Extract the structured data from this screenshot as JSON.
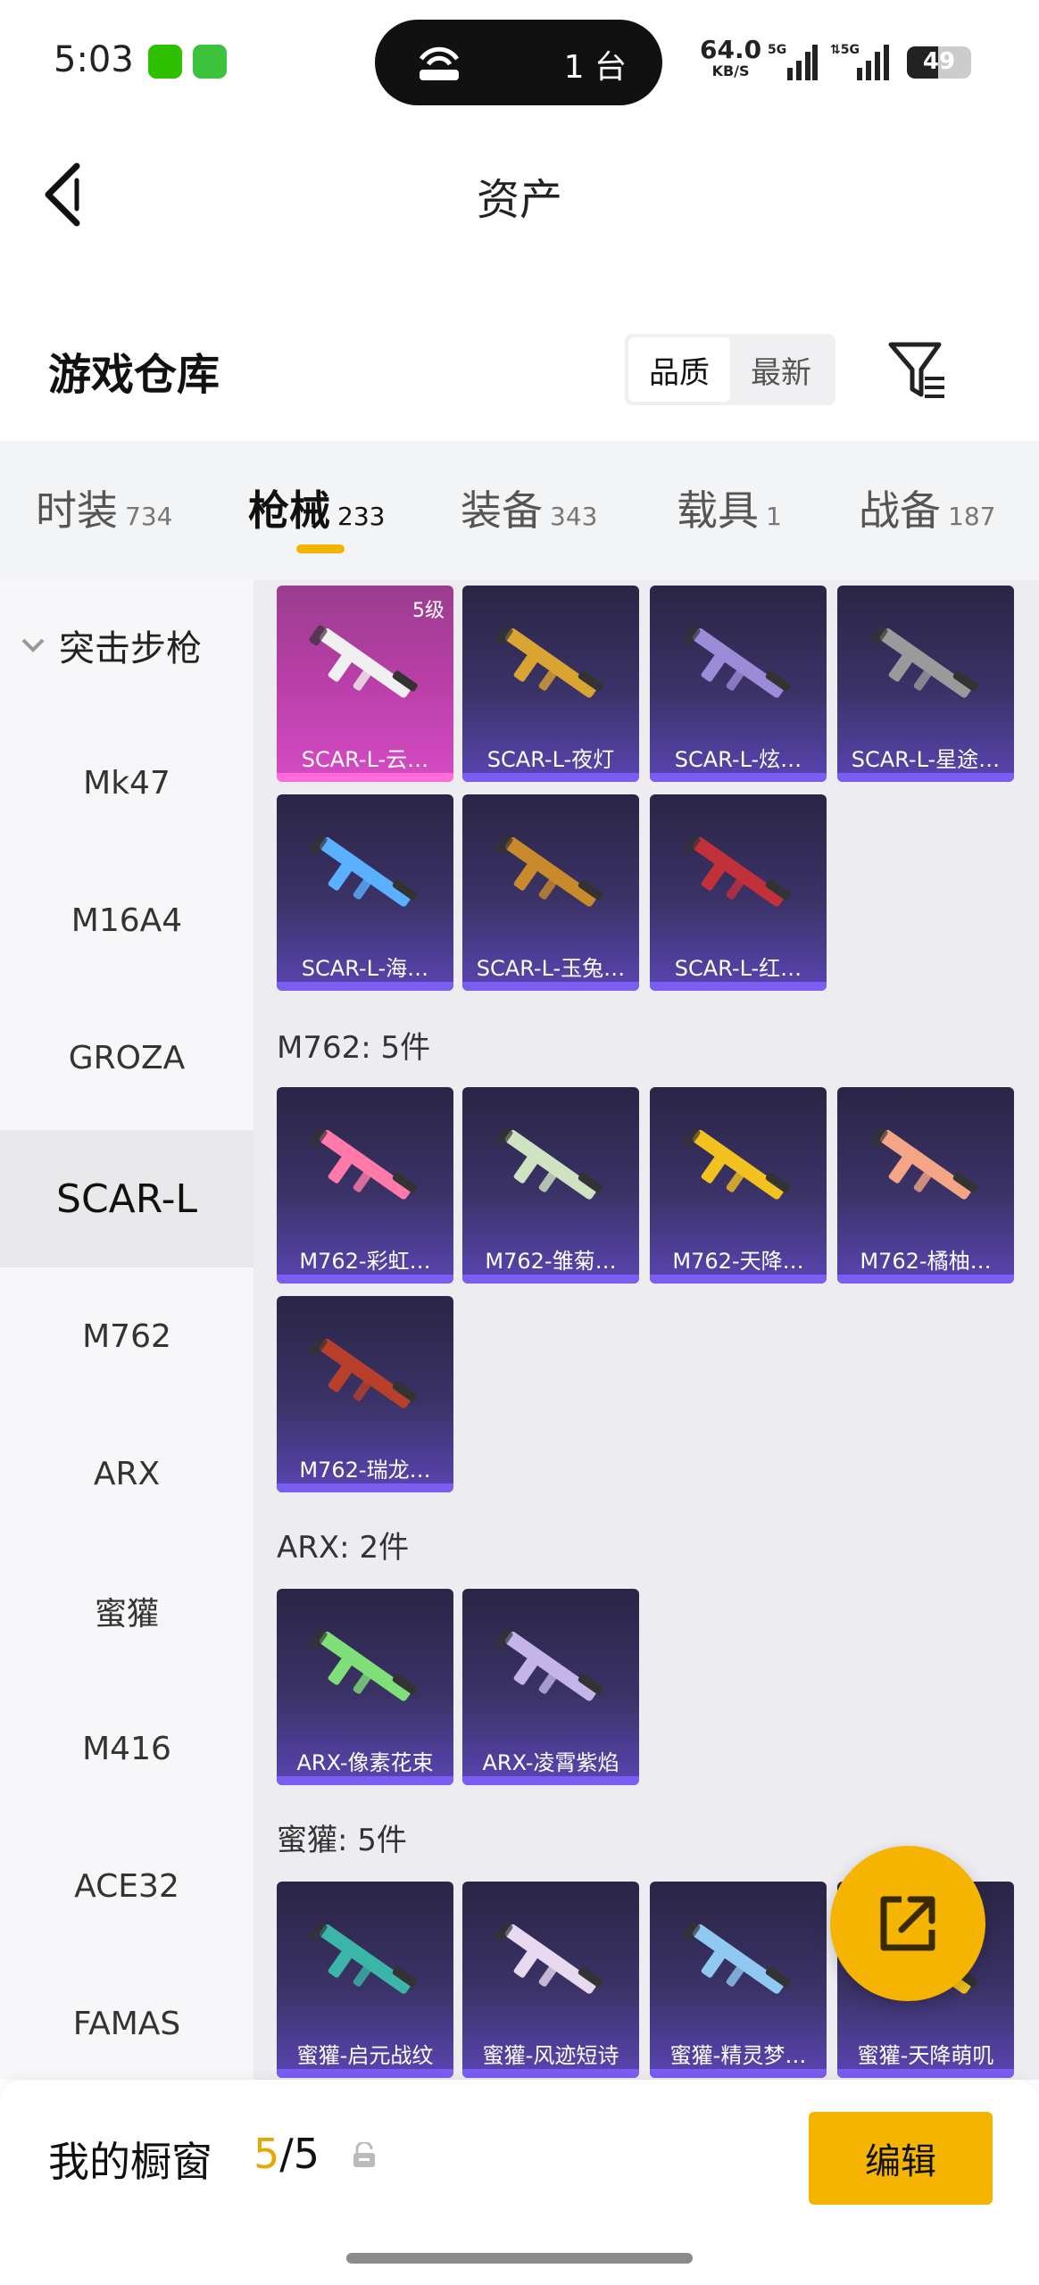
{
  "status": {
    "time": "5:03",
    "hotspot_count": "1 台",
    "net_speed": "64.0",
    "net_unit": "KB/S",
    "sim1": "5G",
    "sim2": "5G",
    "battery": "49",
    "battery_level": 0.49
  },
  "header": {
    "title": "资产"
  },
  "section": {
    "title": "游戏仓库",
    "sort_options": [
      "品质",
      "最新"
    ],
    "sort_selected": "品质"
  },
  "tabs": [
    {
      "name": "时装",
      "count": "734"
    },
    {
      "name": "枪械",
      "count": "233",
      "active": true
    },
    {
      "name": "装备",
      "count": "343"
    },
    {
      "name": "载具",
      "count": "1"
    },
    {
      "name": "战备",
      "count": "187"
    }
  ],
  "sidebar": {
    "category": "突击步枪",
    "items": [
      "Mk47",
      "M16A4",
      "GROZA",
      "SCAR-L",
      "M762",
      "ARX",
      "蜜獾",
      "M416",
      "ACE32",
      "FAMAS"
    ],
    "selected": "SCAR-L"
  },
  "groups": [
    {
      "label": "",
      "items": [
        {
          "name": "SCAR-L-云…",
          "level": "5级",
          "rarity": "legendary",
          "color": "#f0f0f0"
        },
        {
          "name": "SCAR-L-夜灯",
          "color": "#d9a431"
        },
        {
          "name": "SCAR-L-炫…",
          "color": "#9c8cd8"
        },
        {
          "name": "SCAR-L-星途…",
          "color": "#9a9a9a"
        },
        {
          "name": "SCAR-L-海…",
          "color": "#5ab0ff"
        },
        {
          "name": "SCAR-L-玉兔…",
          "color": "#c98a2c"
        },
        {
          "name": "SCAR-L-红…",
          "color": "#c2303a"
        }
      ]
    },
    {
      "label": "M762: 5件",
      "items": [
        {
          "name": "M762-彩虹…",
          "color": "#ff7aa8"
        },
        {
          "name": "M762-雏菊…",
          "color": "#cfe3c2"
        },
        {
          "name": "M762-天降…",
          "color": "#f3c21f"
        },
        {
          "name": "M762-橘柚…",
          "color": "#f4a585"
        },
        {
          "name": "M762-瑞龙…",
          "color": "#b8402a"
        }
      ]
    },
    {
      "label": "ARX: 2件",
      "items": [
        {
          "name": "ARX-像素花束",
          "color": "#7fe07a"
        },
        {
          "name": "ARX-凌霄紫焰",
          "color": "#c5b4e8"
        }
      ]
    },
    {
      "label": "蜜獾: 5件",
      "items": [
        {
          "name": "蜜獾-启元战纹",
          "color": "#3bb5a8"
        },
        {
          "name": "蜜獾-风迹短诗",
          "color": "#e8d8f0"
        },
        {
          "name": "蜜獾-精灵梦…",
          "color": "#8fc8f0"
        },
        {
          "name": "蜜獾-天降萌叽",
          "color": "#f3c21f"
        }
      ]
    }
  ],
  "showcase": {
    "label": "我的橱窗",
    "current": "5",
    "total": "/5",
    "edit_label": "编辑"
  },
  "icons": {
    "back": "back-arrow-icon",
    "filter": "filter-icon",
    "share": "share-external-icon",
    "lock": "lock-icon"
  }
}
